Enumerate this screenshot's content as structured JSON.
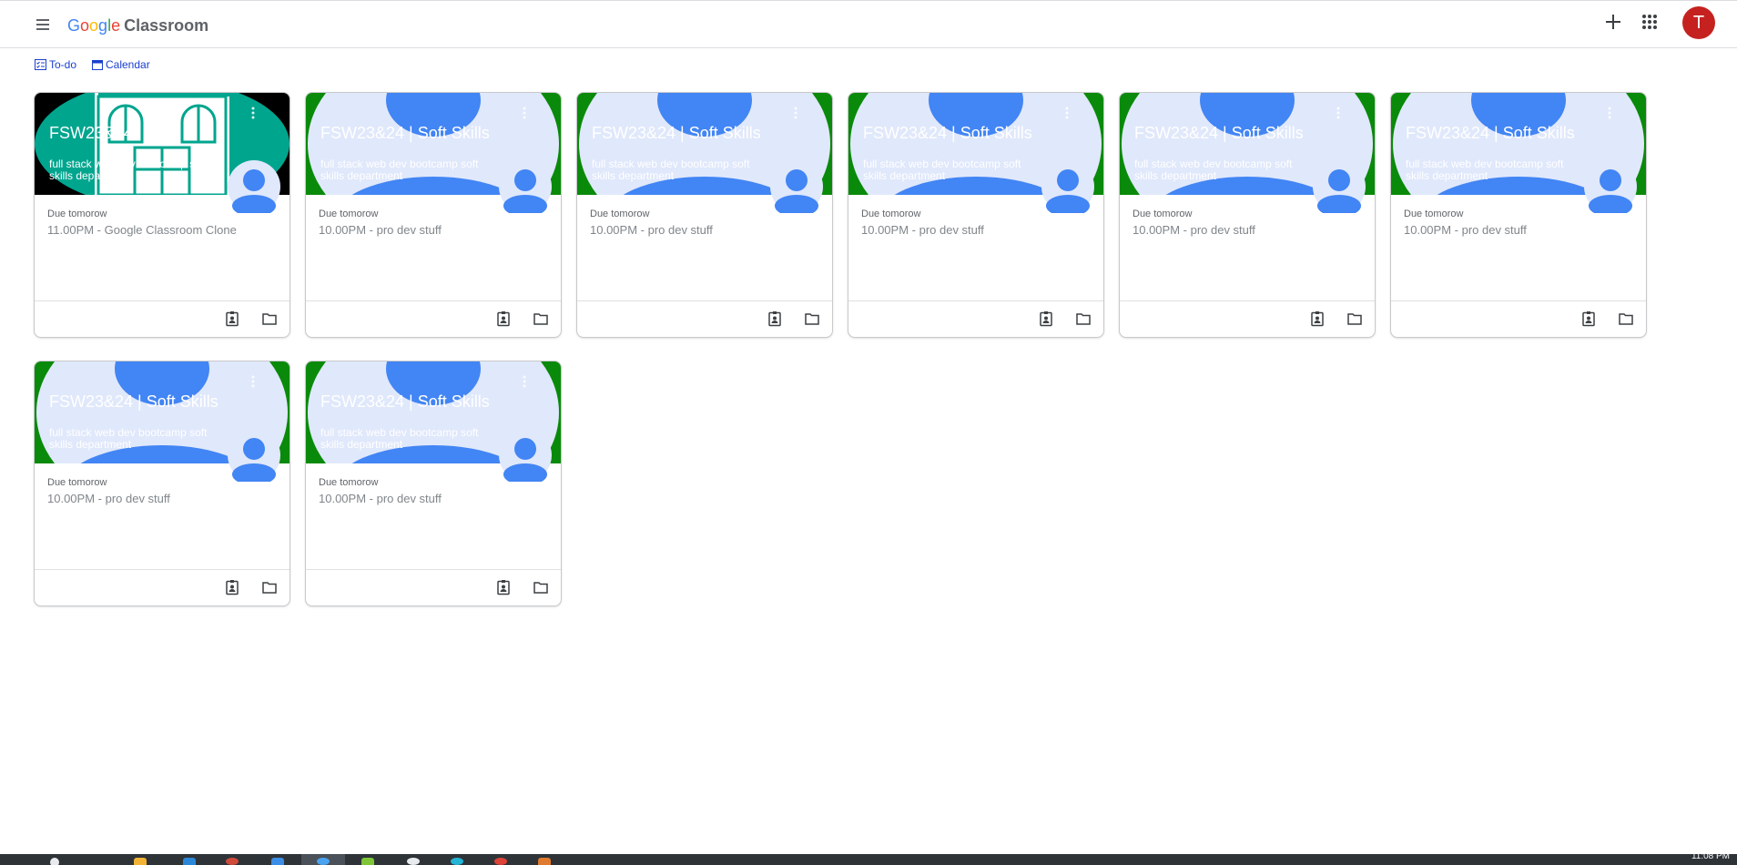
{
  "header": {
    "brand_google": "Google",
    "brand_product": "Classroom",
    "avatar_letter": "T",
    "icons": [
      "menu-icon",
      "plus-icon",
      "apps-grid-icon"
    ]
  },
  "links": {
    "todo": "To-do",
    "calendar": "Calendar"
  },
  "cards": [
    {
      "title": "FSW23&24",
      "subtitle": "full stack web dev bootcamp soft skills department",
      "due_label": "Due tomorow",
      "due_item": "11.00PM - Google Classroom Clone",
      "theme": "teal"
    },
    {
      "title": "FSW23&24 | Soft Skills",
      "subtitle": "full stack web dev bootcamp soft skills department",
      "due_label": "Due tomorow",
      "due_item": "10.00PM - pro dev stuff",
      "theme": "green"
    },
    {
      "title": "FSW23&24 | Soft Skills",
      "subtitle": "full stack web dev bootcamp soft skills department",
      "due_label": "Due tomorow",
      "due_item": "10.00PM - pro dev stuff",
      "theme": "green"
    },
    {
      "title": "FSW23&24 | Soft Skills",
      "subtitle": "full stack web dev bootcamp soft skills department",
      "due_label": "Due tomorow",
      "due_item": "10.00PM - pro dev stuff",
      "theme": "green"
    },
    {
      "title": "FSW23&24 | Soft Skills",
      "subtitle": "full stack web dev bootcamp soft skills department",
      "due_label": "Due tomorow",
      "due_item": "10.00PM - pro dev stuff",
      "theme": "green"
    },
    {
      "title": "FSW23&24 | Soft Skills",
      "subtitle": "full stack web dev bootcamp soft skills department",
      "due_label": "Due tomorow",
      "due_item": "10.00PM - pro dev stuff",
      "theme": "green"
    },
    {
      "title": "FSW23&24 | Soft Skills",
      "subtitle": "full stack web dev bootcamp soft skills department",
      "due_label": "Due tomorow",
      "due_item": "10.00PM - pro dev stuff",
      "theme": "green"
    },
    {
      "title": "FSW23&24 | Soft Skills",
      "subtitle": "full stack web dev bootcamp soft skills department",
      "due_label": "Due tomorow",
      "due_item": "10.00PM - pro dev stuff",
      "theme": "green"
    }
  ],
  "colors": {
    "teal": "#00a58e",
    "green": "#0a8a0a",
    "pale_blue": "#e0e8fb",
    "blue": "#4285f4",
    "avatar": "#c5221f"
  },
  "taskbar": {
    "clock": "11:08 PM"
  }
}
